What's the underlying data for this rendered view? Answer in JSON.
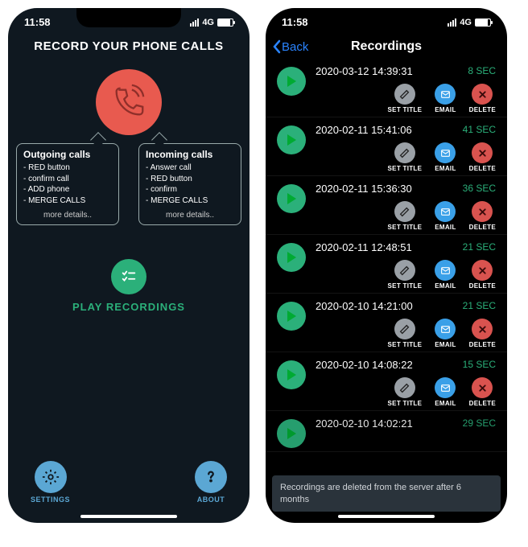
{
  "status": {
    "time": "11:58",
    "carrier": "4G"
  },
  "screen1": {
    "title": "RECORD YOUR PHONE CALLS",
    "outgoing": {
      "heading": "Outgoing calls",
      "items": [
        "RED button",
        "confirm call",
        "ADD phone",
        "MERGE CALLS"
      ],
      "more": "more details.."
    },
    "incoming": {
      "heading": "Incoming calls",
      "items": [
        "Answer call",
        "RED button",
        "confirm",
        "MERGE CALLS"
      ],
      "more": "more details.."
    },
    "play_label": "PLAY RECORDINGS",
    "footer": {
      "settings": "SETTINGS",
      "about": "ABOUT"
    }
  },
  "screen2": {
    "back": "Back",
    "title": "Recordings",
    "action_labels": {
      "set_title": "SET TITLE",
      "email": "EMAIL",
      "delete": "DELETE"
    },
    "recordings": [
      {
        "timestamp": "2020-03-12 14:39:31",
        "duration": "8 SEC"
      },
      {
        "timestamp": "2020-02-11 15:41:06",
        "duration": "41 SEC"
      },
      {
        "timestamp": "2020-02-11 15:36:30",
        "duration": "36 SEC"
      },
      {
        "timestamp": "2020-02-11 12:48:51",
        "duration": "21 SEC"
      },
      {
        "timestamp": "2020-02-10 14:21:00",
        "duration": "21 SEC"
      },
      {
        "timestamp": "2020-02-10 14:08:22",
        "duration": "15 SEC"
      },
      {
        "timestamp": "2020-02-10 14:02:21",
        "duration": "29 SEC"
      }
    ],
    "toast": "Recordings are deleted from the server after 6 months"
  }
}
